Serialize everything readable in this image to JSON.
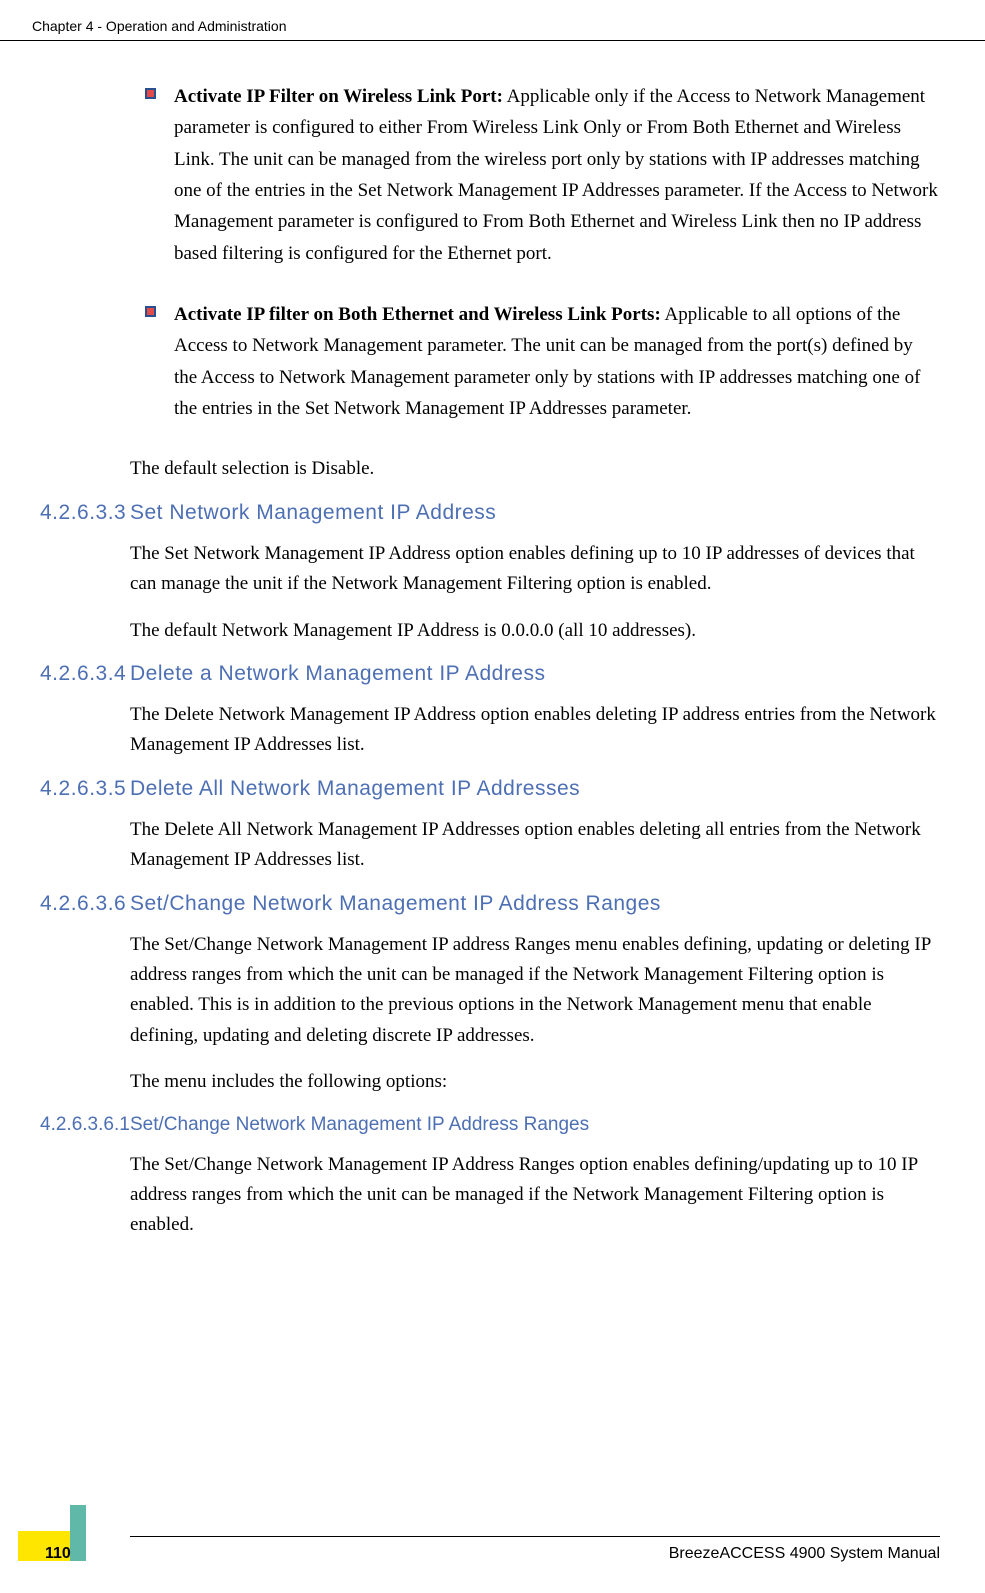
{
  "chapter_header": "Chapter 4 - Operation and Administration",
  "bullets": [
    {
      "lead": "Activate IP Filter on Wireless Link Port:",
      "body": " Applicable only if the Access to Network Management parameter is configured to either From Wireless Link Only or From Both Ethernet and Wireless Link. The unit can be managed from the wireless port only by stations with IP addresses matching one of the entries in the Set Network Management IP Addresses parameter. If the Access to Network Management parameter is configured to From Both Ethernet and Wireless Link then no IP address based filtering is configured for the Ethernet port."
    },
    {
      "lead": "Activate IP filter on Both Ethernet and Wireless Link Ports:",
      "body": " Applicable to all options of the Access to Network Management parameter. The unit can be managed from the port(s) defined by the Access to Network Management parameter only by stations with IP addresses matching one of the entries in the Set Network Management IP Addresses parameter."
    }
  ],
  "default_selection_para": "The default selection is Disable.",
  "sections": {
    "s3": {
      "num": "4.2.6.3.3",
      "title": "Set Network Management IP Address",
      "p1": "The Set Network Management IP Address option enables defining up to 10 IP addresses of devices that can manage the unit if the Network Management Filtering option is enabled.",
      "p2": "The default Network Management IP Address is 0.0.0.0 (all 10 addresses)."
    },
    "s4": {
      "num": "4.2.6.3.4",
      "title": "Delete a Network Management IP Address",
      "p1": "The Delete Network Management IP Address option enables deleting IP address entries from the Network Management IP Addresses list."
    },
    "s5": {
      "num": "4.2.6.3.5",
      "title": "Delete All Network Management IP Addresses",
      "p1": "The Delete All Network Management IP Addresses option enables deleting all entries from the Network Management IP Addresses list."
    },
    "s6": {
      "num": "4.2.6.3.6",
      "title": "Set/Change Network Management IP Address Ranges",
      "p1": "The Set/Change Network Management IP address Ranges menu enables defining, updating or deleting IP address ranges from which the unit can be managed if the Network Management Filtering option is enabled. This is in addition to the previous options in the Network Management menu that enable defining, updating and deleting discrete IP addresses.",
      "p2": "The menu includes the following options:"
    },
    "s61": {
      "num": "4.2.6.3.6.1",
      "title": "Set/Change Network Management IP Address Ranges",
      "p1": "The Set/Change Network Management IP Address Ranges option enables defining/updating up to 10 IP address ranges from which the unit can be managed if the Network Management Filtering option is enabled."
    }
  },
  "footer_text": "BreezeACCESS 4900 System Manual",
  "page_number": "110"
}
